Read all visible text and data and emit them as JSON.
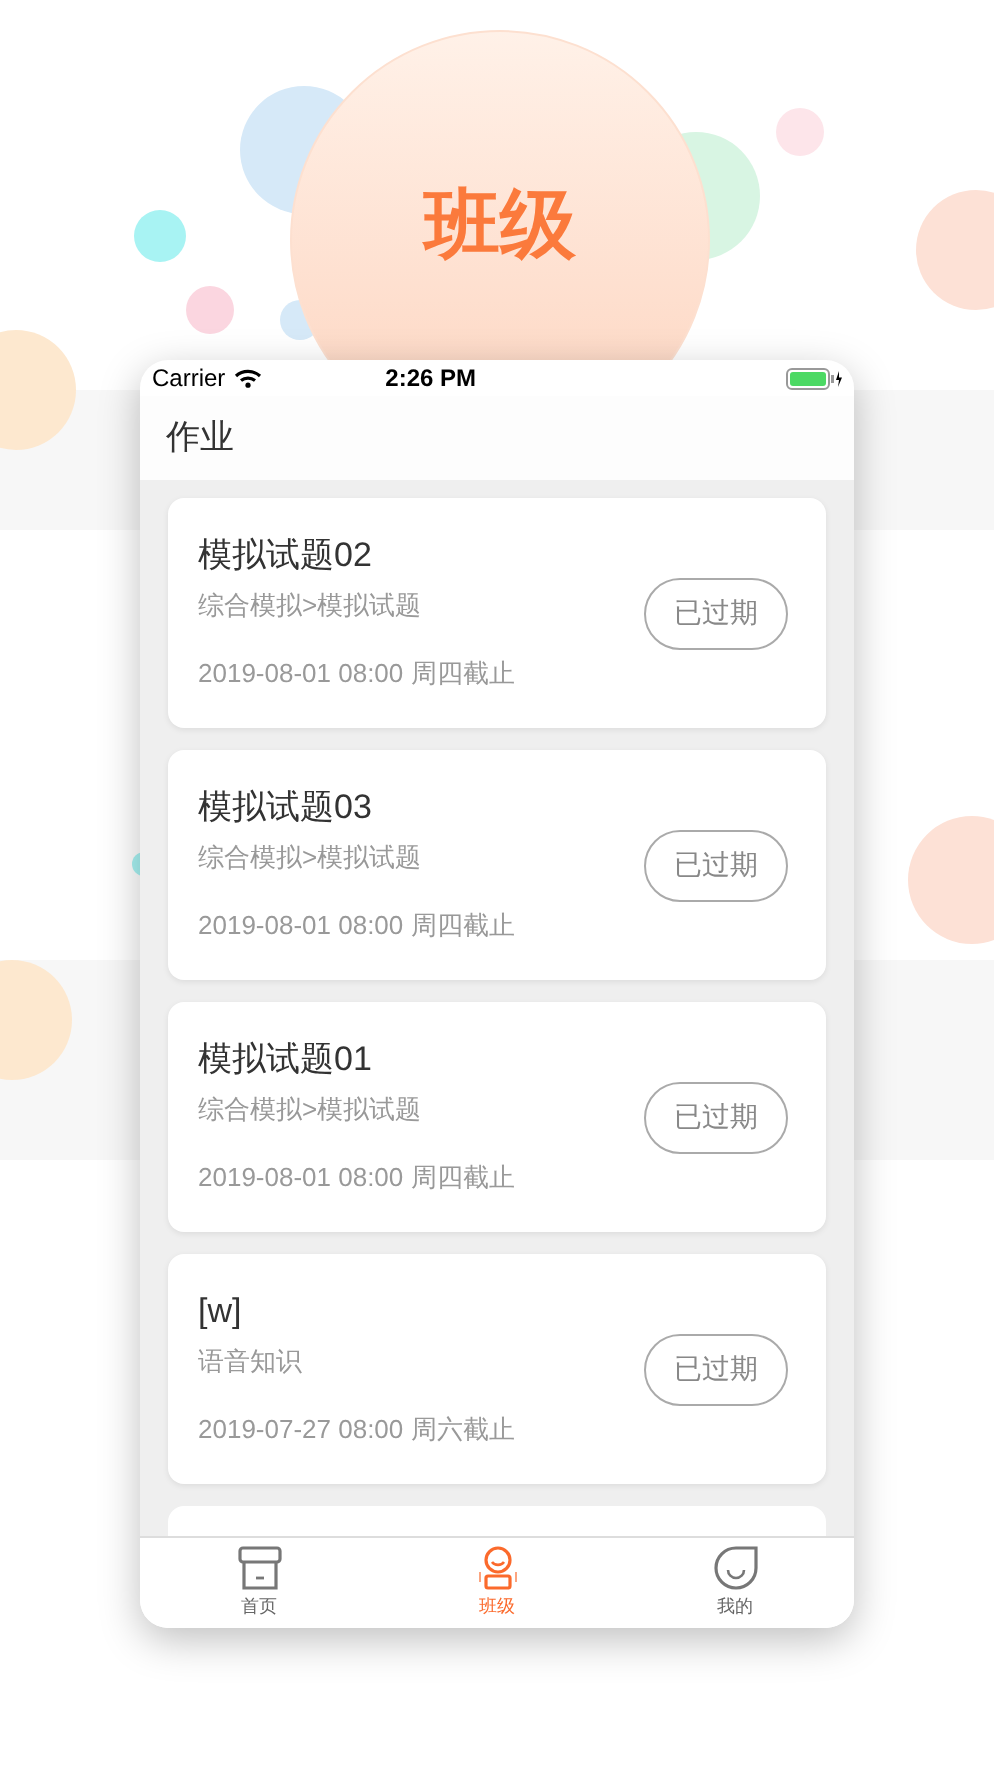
{
  "banner": {
    "title": "班级"
  },
  "status_bar": {
    "carrier": "Carrier",
    "time": "2:26 PM"
  },
  "header": {
    "title": "作业"
  },
  "assignments": [
    {
      "title": "模拟试题02",
      "category": "综合模拟>模拟试题",
      "deadline": "2019-08-01 08:00 周四截止",
      "status": "已过期"
    },
    {
      "title": "模拟试题03",
      "category": "综合模拟>模拟试题",
      "deadline": "2019-08-01 08:00 周四截止",
      "status": "已过期"
    },
    {
      "title": "模拟试题01",
      "category": "综合模拟>模拟试题",
      "deadline": "2019-08-01 08:00 周四截止",
      "status": "已过期"
    },
    {
      "title": "[w]",
      "category": "语音知识",
      "deadline": "2019-07-27 08:00 周六截止",
      "status": "已过期"
    }
  ],
  "tabs": [
    {
      "kind": "home",
      "label": "首页",
      "selected": false
    },
    {
      "kind": "class",
      "label": "班级",
      "selected": true
    },
    {
      "kind": "me",
      "label": "我的",
      "selected": false
    }
  ]
}
